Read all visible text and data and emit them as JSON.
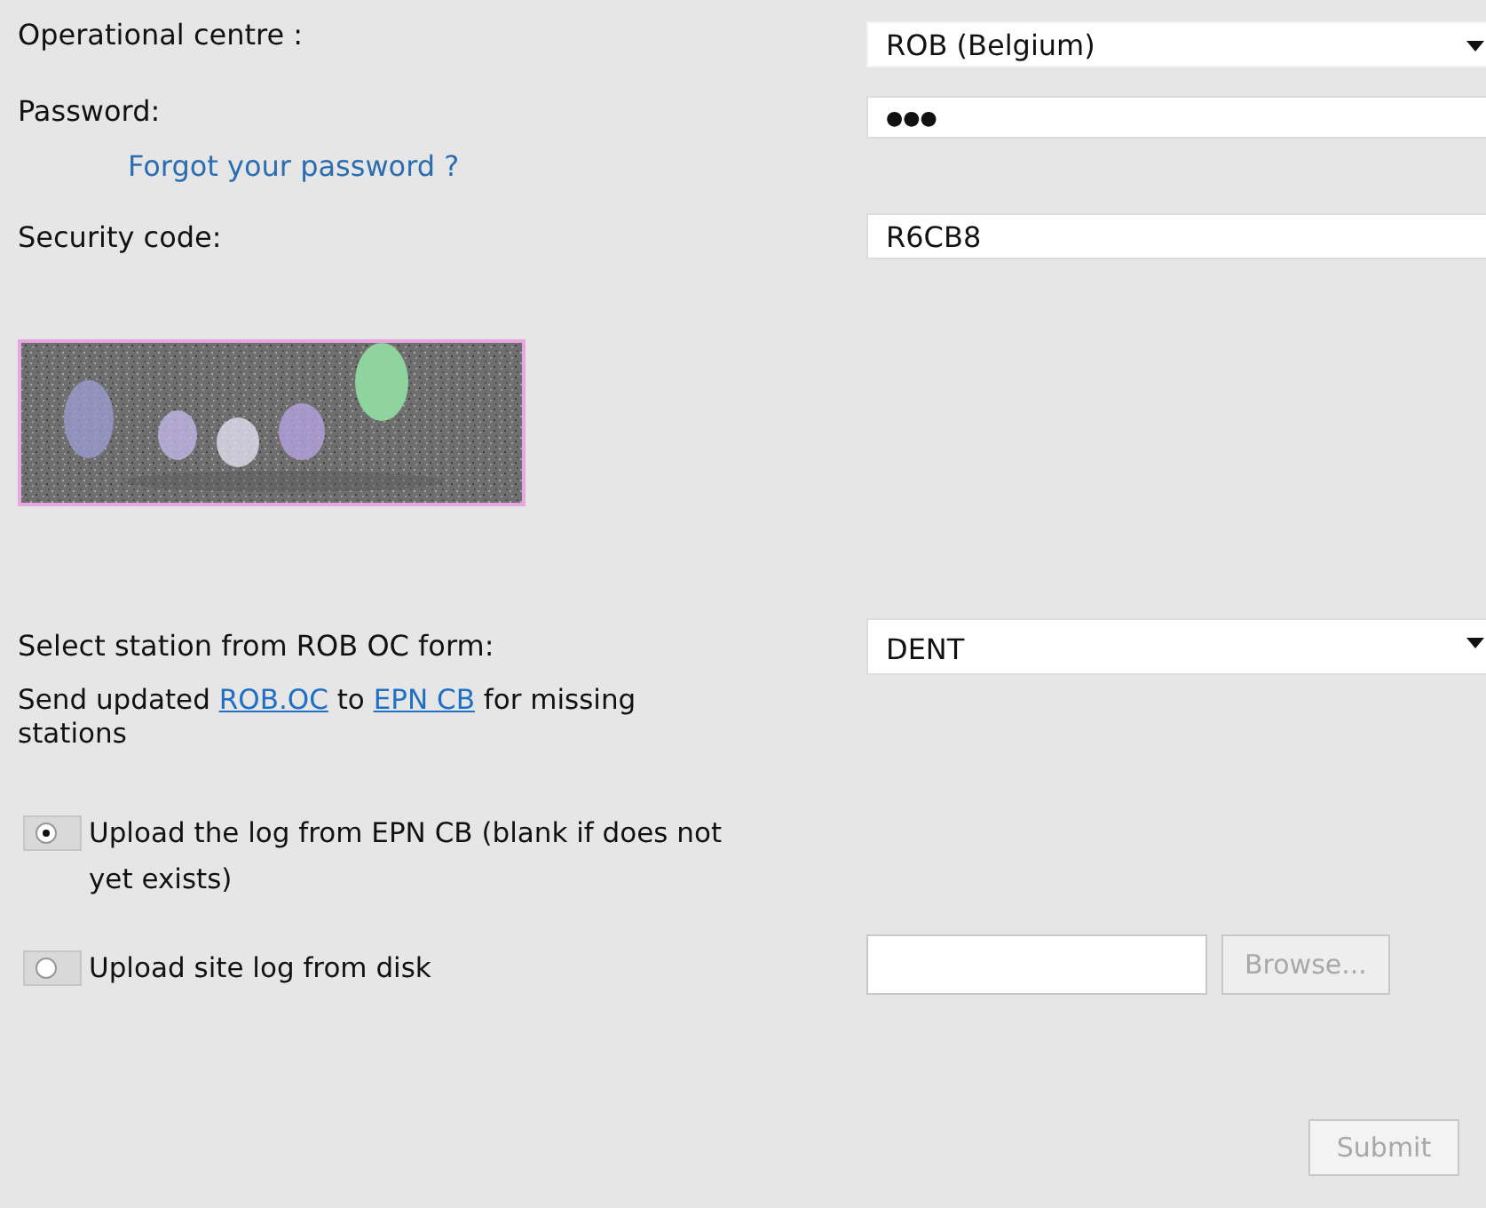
{
  "form": {
    "rows": [
      {
        "kind": "select",
        "label": "Operational centre :",
        "value": "ROB (Belgium)"
      },
      {
        "kind": "password",
        "label": "Password:",
        "value": "●●●"
      },
      {
        "kind": "link",
        "label": "Forgot your password ?"
      },
      {
        "kind": "text",
        "label": "Security code:",
        "value": "R6CB8"
      },
      {
        "kind": "picture"
      },
      {
        "kind": "select",
        "label": "Select station from ROB OC form:",
        "value": "DENT"
      },
      {
        "kind": "note",
        "segments": [
          {
            "text": "Send updated ",
            "link": false
          },
          {
            "text": "ROB.OC",
            "link": true
          },
          {
            "text": " to ",
            "link": false
          },
          {
            "text": "EPN CB",
            "link": true
          },
          {
            "text": " for missing stations",
            "link": false
          }
        ]
      },
      {
        "kind": "radio",
        "label": "Upload the log from EPN CB (blank if does not yet exists)",
        "selected": true
      },
      {
        "kind": "radio",
        "label": "Upload site log from disk",
        "selected": false,
        "file_button": {
          "label": "Browse...",
          "disabled": true
        }
      },
      {
        "kind": "submit",
        "label": "Submit",
        "disabled": true
      }
    ]
  }
}
